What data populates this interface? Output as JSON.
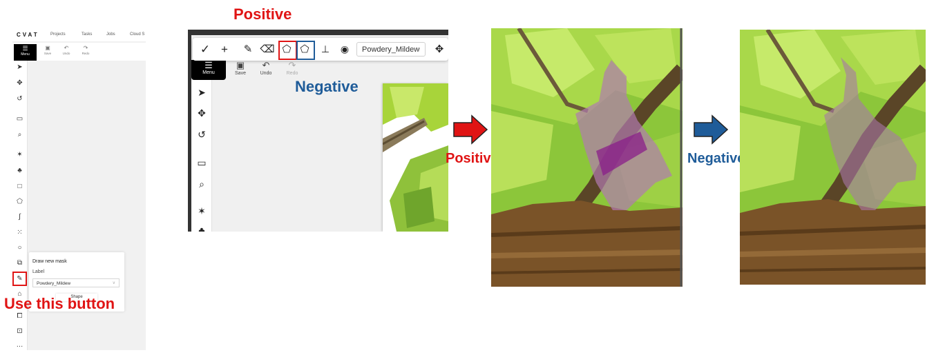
{
  "captions": {
    "top_positive": "Positive",
    "negative_overlay": "Negative",
    "use_button": "Use this button",
    "arrow1_label": "Positive",
    "arrow2_label": "Negative"
  },
  "colors": {
    "positive_red": "#e01414",
    "negative_blue": "#1f5c99"
  },
  "cvat_panel": {
    "logo": "CVAT",
    "nav": [
      "Projects",
      "Tasks",
      "Jobs",
      "Cloud S"
    ],
    "menu_label": "Menu",
    "toolbar": {
      "save": "Save",
      "undo": "Undo",
      "redo": "Redo"
    },
    "sidebar_icons": [
      "cursor-icon",
      "move-icon",
      "rotate-icon",
      "rectangle-fit-icon",
      "zoom-region-icon",
      "magic-wand-icon",
      "ai-tools-icon",
      "rectangle-icon",
      "polygon-icon",
      "polyline-icon",
      "points-icon",
      "ellipse-icon",
      "cuboid-icon",
      "brush-mask-icon",
      "tag-icon",
      "group-icon",
      "split-icon",
      "more-icon"
    ],
    "popup": {
      "title": "Draw new mask",
      "label_caption": "Label",
      "label_value": "Powdery_Mildew",
      "shape_button": "Shape"
    }
  },
  "zoom_panel": {
    "toolbar_icons": [
      "check-icon",
      "plus-icon",
      "brush-icon",
      "eraser-icon",
      "polygon-plus-icon",
      "polygon-minus-icon",
      "baseline-icon",
      "eye-icon"
    ],
    "label_value": "Powdery_Mildew",
    "menu_label": "Menu",
    "toolbar": {
      "save": "Save",
      "undo": "Undo",
      "redo": "Redo"
    }
  }
}
